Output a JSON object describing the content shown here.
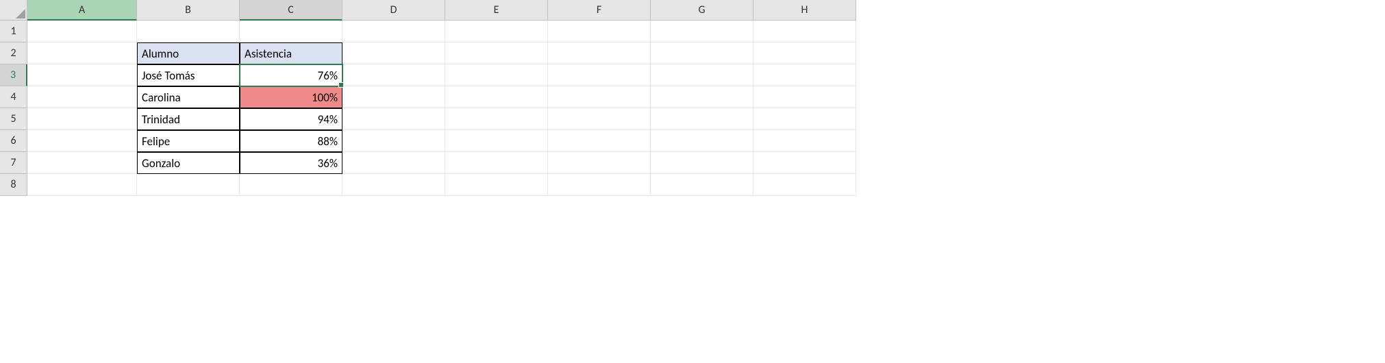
{
  "columns": [
    "A",
    "B",
    "C",
    "D",
    "E",
    "F",
    "G",
    "H"
  ],
  "rows": [
    "1",
    "2",
    "3",
    "4",
    "5",
    "6",
    "7",
    "8"
  ],
  "activeColumn": "A",
  "selectedColumn": "C",
  "selectedRow": "3",
  "activeCell": "C3",
  "table": {
    "headers": {
      "student": "Alumno",
      "attendance": "Asistencia"
    },
    "rows": [
      {
        "student": "José Tomás",
        "attendance": "76%",
        "highlight": false
      },
      {
        "student": "Carolina",
        "attendance": "100%",
        "highlight": true
      },
      {
        "student": "Trinidad",
        "attendance": "94%",
        "highlight": false
      },
      {
        "student": "Felipe",
        "attendance": "88%",
        "highlight": false
      },
      {
        "student": "Gonzalo",
        "attendance": "36%",
        "highlight": false
      }
    ]
  },
  "chart_data": {
    "type": "table",
    "title": "",
    "columns": [
      "Alumno",
      "Asistencia"
    ],
    "rows": [
      [
        "José Tomás",
        "76%"
      ],
      [
        "Carolina",
        "100%"
      ],
      [
        "Trinidad",
        "94%"
      ],
      [
        "Felipe",
        "88%"
      ],
      [
        "Gonzalo",
        "36%"
      ]
    ]
  }
}
